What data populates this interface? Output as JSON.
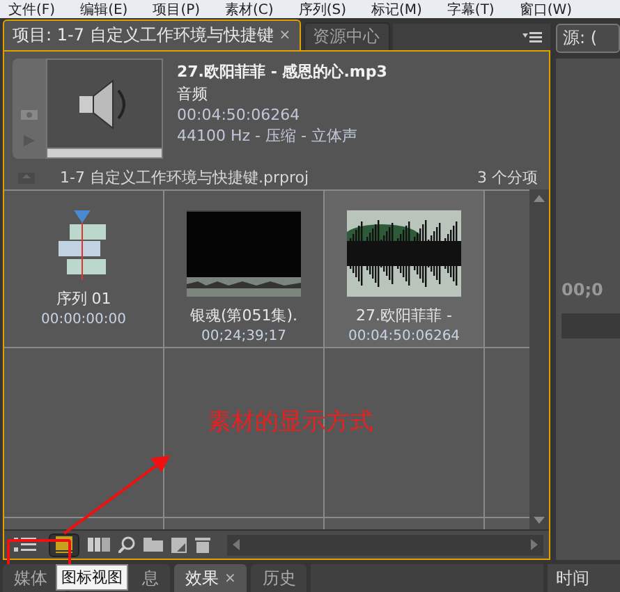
{
  "menu_bar": [
    "文件(F)",
    "编辑(E)",
    "项目(P)",
    "素材(C)",
    "序列(S)",
    "标记(M)",
    "字幕(T)",
    "窗口(W)"
  ],
  "project_panel": {
    "tabs": [
      {
        "label": "项目: 1-7 自定义工作环境与快捷键",
        "selected": true,
        "close": "×"
      },
      {
        "label": "资源中心",
        "selected": false
      }
    ],
    "preview": {
      "title": "27.欧阳菲菲 - 感恩的心.mp3",
      "type": "音频",
      "duration": "00:04:50:06264",
      "format": "44100 Hz - 压缩 - 立体声"
    },
    "project_path": "1-7 自定义工作环境与快捷键.prproj",
    "item_count": "3 个分项",
    "items": [
      {
        "kind": "sequence",
        "name": "序列 01",
        "time": "00:00:00:00",
        "selected": false
      },
      {
        "kind": "video",
        "name": "银魂(第051集).",
        "time": "00;24;39;17",
        "selected": false
      },
      {
        "kind": "audio",
        "name": "27.欧阳菲菲 -",
        "time": "00:04:50:06264",
        "selected": true
      }
    ],
    "view_buttons": [
      {
        "kind": "list",
        "selected": false
      },
      {
        "kind": "icon",
        "selected": true
      }
    ],
    "tooltip": "图标视图"
  },
  "right_panel": {
    "tab": "源: (",
    "timecode": "00;0",
    "bottom_tab": "时间"
  },
  "bottom_tabs": [
    {
      "label": "媒体",
      "selected": false
    },
    {
      "label": "息",
      "selected": false
    },
    {
      "label": "效果",
      "selected": true,
      "close": "×"
    },
    {
      "label": "历史",
      "selected": false
    }
  ],
  "annotation": {
    "text": "素材的显示方式"
  }
}
